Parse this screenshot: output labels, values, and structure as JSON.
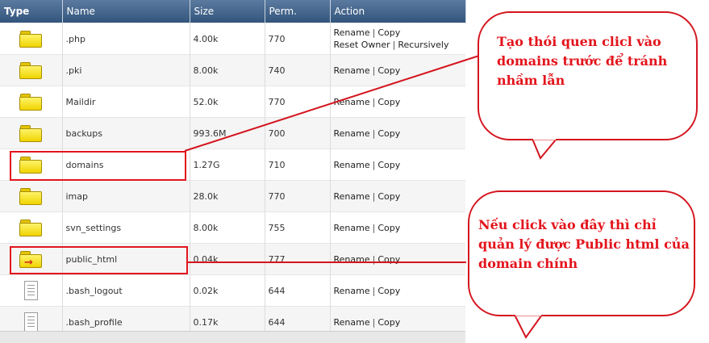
{
  "columns": {
    "type": "Type",
    "name": "Name",
    "size": "Size",
    "perm": "Perm.",
    "action": "Action"
  },
  "actions": {
    "rename": "Rename",
    "copy": "Copy",
    "reset_owner": "Reset Owner",
    "recursively": "Recursively"
  },
  "rows": [
    {
      "icon": "folder-icon",
      "name": ".php",
      "size": "4.00k",
      "perm": "770"
    },
    {
      "icon": "folder-icon",
      "name": ".pki",
      "size": "8.00k",
      "perm": "740"
    },
    {
      "icon": "folder-icon",
      "name": "Maildir",
      "size": "52.0k",
      "perm": "770"
    },
    {
      "icon": "folder-icon",
      "name": "backups",
      "size": "993.6M",
      "perm": "700"
    },
    {
      "icon": "folder-icon",
      "name": "domains",
      "size": "1.27G",
      "perm": "710"
    },
    {
      "icon": "folder-icon",
      "name": "imap",
      "size": "28.0k",
      "perm": "770"
    },
    {
      "icon": "folder-icon",
      "name": "svn_settings",
      "size": "8.00k",
      "perm": "755"
    },
    {
      "icon": "folder-link-icon",
      "name": "public_html",
      "size": "0.04k",
      "perm": "777"
    },
    {
      "icon": "document-icon",
      "name": ".bash_logout",
      "size": "0.02k",
      "perm": "644"
    },
    {
      "icon": "document-icon",
      "name": ".bash_profile",
      "size": "0.17k",
      "perm": "644"
    }
  ],
  "callouts": {
    "top": "Tạo thói quen clicl vào domains trước để tránh nhầm lẫn",
    "bottom": "Nếu click vào đây thì chỉ quản lý được Public html của domain chính"
  },
  "colors": {
    "header": "#3f6189",
    "annotation": "#e3141c"
  }
}
